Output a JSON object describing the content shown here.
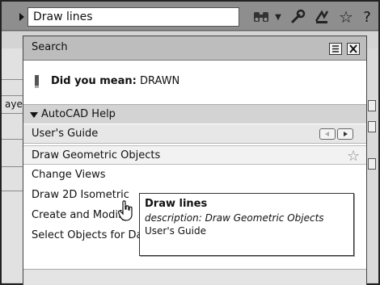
{
  "toolbar": {
    "search_value": "Draw lines"
  },
  "panel": {
    "title": "Search",
    "did_you_mean_prefix": "Did you mean:",
    "did_you_mean_term": "DRAWN",
    "group_label": "AutoCAD Help",
    "sub_label": "User's Guide",
    "results": [
      "Draw Geometric Objects",
      "Change Views",
      "Draw 2D Isometric",
      "Create and Modify",
      "Select Objects for Data Extraction"
    ]
  },
  "tooltip": {
    "title": "Draw lines",
    "description": "description: Draw Geometric Objects",
    "source": "User's Guide"
  },
  "background": {
    "left_fragment": "aye"
  }
}
